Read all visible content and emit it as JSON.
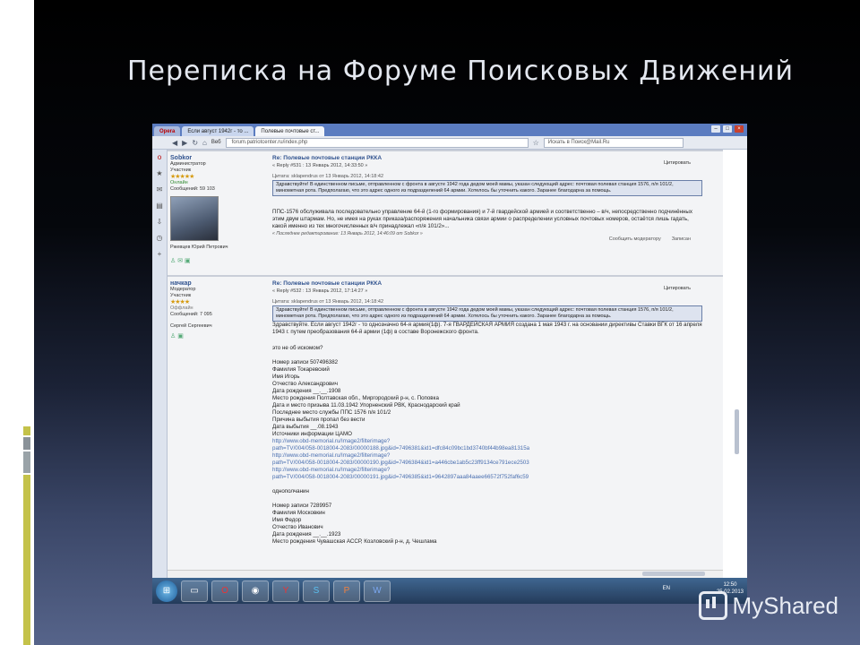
{
  "slide": {
    "title": "Переписка на Форуме Поисковых Движений",
    "watermark": "MyShared"
  },
  "browser": {
    "tabs": [
      {
        "label": "Opera"
      },
      {
        "label": "Если август 1942г - то ..."
      },
      {
        "label": "Полевые почтовые ст..."
      }
    ],
    "web_label": "Веб",
    "url": "forum.patriotcenter.ru/index.php",
    "search_placeholder": "Искать в Поиск@Mail.Ru"
  },
  "posts": [
    {
      "author": "Sobkor",
      "role": "Администратор",
      "group": "Участник",
      "status": "Онлайн",
      "messages": "Сообщений: 59 103",
      "full_name": "Ржевцев Юрий Петрович",
      "subject": "Re: Полевые почтовые станции РККА",
      "reply": "« Reply #531 : 13 Январь 2012, 14:33:50 »",
      "quote_head": "Цитата: sklapendrus от 13 Январь 2012, 14:18:42",
      "quote": "Здравствуйте! В единственном письме, отправленном с фронта в августе 1942 года дедом моей мамы, указан следующий адрес: почтовая полевая станция 1576, п/я 101/2, минометная рота. Предполагаю, что это адрес одного из подразделений 64 армии. Хотелось бы уточнить какого. Заранее благодарна за помощь.",
      "text": "ППС-1576 обслуживала последовательно управление 64-й (1-го формирования) и 7-й гвардейской армией и соответственно – в/ч, непосредственно подчинённых этим двум штармам. Но, не имея на руках приказа/распоряжения начальника связи армии о распределении условных почтовых номеров, остаётся лишь гадать, какой именно из тех многочисленных в/ч принадлежал «п/я 101/2»...",
      "edited": "« Последнее редактирование: 13 Январь 2012, 14:46:09 от Sobkor »",
      "cite": "Цитировать",
      "report": "Сообщить модератору",
      "logged": "Записан"
    },
    {
      "author": "начкар",
      "role": "Модератор",
      "group": "Участник",
      "status": "Оффлайн",
      "messages": "Сообщений: 7 095",
      "full_name": "Сергей Сергеевич",
      "subject": "Re: Полевые почтовые станции РККА",
      "reply": "« Reply #532 : 13 Январь 2012, 17:14:27 »",
      "quote_head": "Цитата: sklapendrus от 13 Январь 2012, 14:18:42",
      "quote": "Здравствуйте! В единственном письме, отправленном с фронта в августе 1942 года дедом моей мамы, указан следующий адрес: почтовая полевая станция 1576, п/я 101/2, минометная рота. Предполагаю, что это адрес одного из подразделений 64 армии. Хотелось бы уточнить какого. Заранее благодарна за помощь.",
      "intro": "Здравствуйте. Если август 1942г - то однозначно 64-я армия(1ф). 7-я ГВАРДЕЙСКАЯ АРМИЯ создана 1 мая 1943 г. на основании директивы Ставки ВГК от 16 апреля 1943 г. путем преобразования 64-й армии (1ф) в составе Воронежского фронта.",
      "question": "это не об искомом?",
      "record1": [
        "Номер записи    507496382",
        "Фамилия    Токаревский",
        "Имя    Игорь",
        "Отчество    Александрович",
        "Дата рождения    __.__.1908",
        "Место рождения    Полтавская обл., Миргородский р-н, с. Поповка",
        "Дата и место призыва    11.03.1942 Упорненский РВК, Краснодарский край",
        "Последнее место службы    ППС 1576 п/я 101/2",
        "Причина выбытия    пропал без вести",
        "Дата выбытия    __.08.1943",
        "Источники информации    ЦАМО"
      ],
      "links": [
        "http://www.obd-memorial.ru/Image2/filterimage?",
        "path=TV/004/058-0018004-2083/00000188.jpg&id=7496381&id1=dfc84c09bc1bd3740bf44b98ea81315a",
        "http://www.obd-memorial.ru/Image2/filterimage?",
        "path=TV/004/058-0018004-2083/00000190.jpg&id=7496384&id1=a446cbe1ab5c23ff9134ce791ece2503",
        "http://www.obd-memorial.ru/Image2/filterimage?",
        "path=TV/004/058-0018004-2083/00000191.jpg&id=7496385&id1=9642897aaa84aaee66572f752faf6c59"
      ],
      "fellow": "однополчанин",
      "record2": [
        "Номер записи    7289957",
        "Фамилия    Московкин",
        "Имя    Федор",
        "Отчество    Иванович",
        "Дата рождения    __.__.1923",
        "Место рождения    Чувашская АССР, Козловский р-н, д. Чешлама"
      ],
      "cite": "Цитировать"
    }
  ],
  "taskbar": {
    "lang": "EN",
    "time": "12:50",
    "date": "25.02.2013"
  }
}
